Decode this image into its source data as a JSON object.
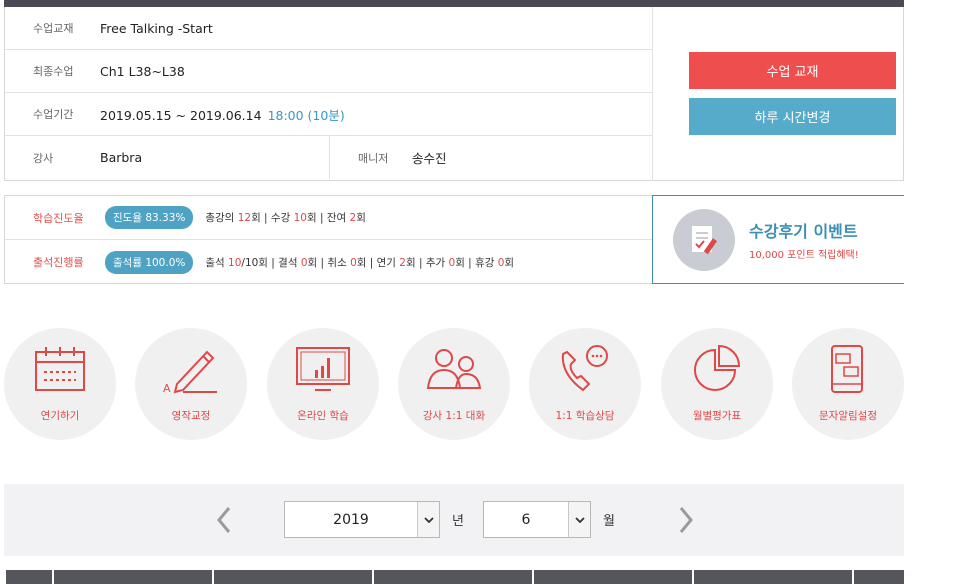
{
  "course": {
    "material_label": "수업교재",
    "material_value": "Free Talking -Start",
    "last_lesson_label": "최종수업",
    "last_lesson_value": "Ch1 L38~L38",
    "period_label": "수업기간",
    "period_value": "2019.05.15 ~ 2019.06.14",
    "period_time": "18:00 (10분)",
    "teacher_label": "강사",
    "teacher_value": "Barbra",
    "manager_label": "매니저",
    "manager_value": "송수진",
    "btn_material": "수업 교재",
    "btn_change_time": "하루 시간변경"
  },
  "progress": {
    "learning_label": "학습진도율",
    "learning_pill": "진도율 83.33%",
    "total_prefix": "총강의 ",
    "total_num": "12",
    "total_unit": "회 | 수강 ",
    "taken_num": "10",
    "taken_unit": "회 | 잔여 ",
    "remain_num": "2",
    "remain_unit": "회",
    "attendance_label": "출석진행률",
    "attendance_pill": "출석률 100.0%",
    "att_prefix": "출석 ",
    "att_num": "10",
    "att_after": "/10회 | 결석 ",
    "absent_num": "0",
    "absent_after": "회 | 취소 ",
    "cancel_num": "0",
    "cancel_after": "회 | 연기 ",
    "postpone_num": "2",
    "postpone_after": "회 | 추가 ",
    "extra_num": "0",
    "extra_after": "회 | 휴강 ",
    "holiday_num": "0",
    "holiday_after": "회"
  },
  "event": {
    "title": "수강후기 이벤트",
    "subtitle": "10,000 포인트 적립혜택!"
  },
  "menu": [
    {
      "label": "연기하기",
      "icon": "calendar-icon"
    },
    {
      "label": "영작교정",
      "icon": "pencil-icon"
    },
    {
      "label": "온라인 학습",
      "icon": "monitor-chart-icon"
    },
    {
      "label": "강사 1:1 대화",
      "icon": "people-icon"
    },
    {
      "label": "1:1 학습상담",
      "icon": "phone-chat-icon"
    },
    {
      "label": "월별평가표",
      "icon": "pie-chart-icon"
    },
    {
      "label": "문자알림설정",
      "icon": "mobile-message-icon"
    }
  ],
  "date_selector": {
    "year": "2019",
    "year_unit": "년",
    "month": "6",
    "month_unit": "월"
  },
  "colors": {
    "accent_red": "#ef4e4e",
    "accent_blue": "#57abca",
    "header_dark": "#4a4a55"
  }
}
